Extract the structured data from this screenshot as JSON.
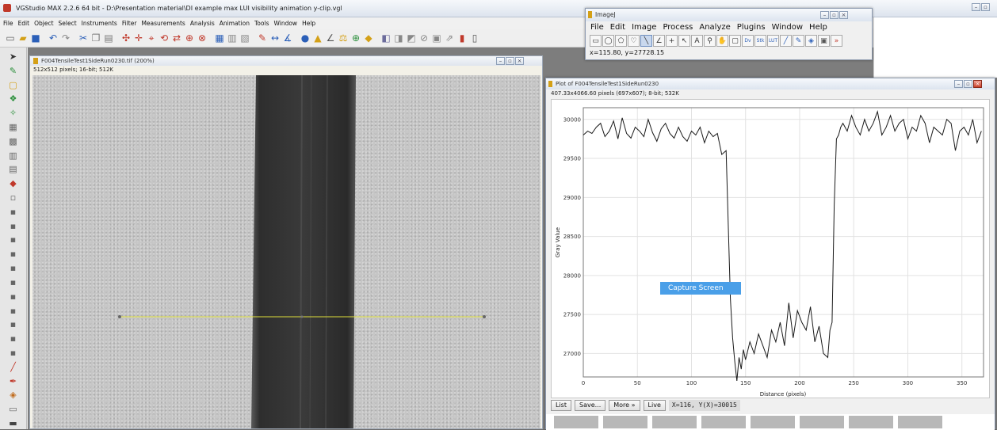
{
  "app": {
    "title": "VGStudio MAX 2.2.6 64 bit - D:\\Presentation material\\DI example max LUI visibility animation y-clip.vgl",
    "menu": [
      "File",
      "Edit",
      "Object",
      "Select",
      "Instruments",
      "Filter",
      "Measurements",
      "Analysis",
      "Animation",
      "Tools",
      "Window",
      "Help"
    ]
  },
  "image_window": {
    "title": "F004TensileTest1SideRun0230.tif (200%)",
    "info": "512x512 pixels; 16-bit; 512K"
  },
  "imagej": {
    "title": "ImageJ",
    "menu": [
      "File",
      "Edit",
      "Image",
      "Process",
      "Analyze",
      "Plugins",
      "Window",
      "Help"
    ],
    "status": "x=115.80, y=27728.15",
    "tools": [
      "rect",
      "oval",
      "poly",
      "free",
      "line",
      "angle",
      "point",
      "wand",
      "text",
      "zoom",
      "hand",
      "dropper",
      "dev",
      "stk",
      "lut",
      "brush",
      "pen",
      "ruler",
      "macro",
      "more"
    ]
  },
  "plot_window": {
    "title": "Plot of F004TensileTest1SideRun0230",
    "info": "407.33x4066.60 pixels (697x607); 8-bit; 532K",
    "buttons": {
      "list": "List",
      "save": "Save...",
      "more": "More »",
      "live": "Live"
    },
    "readout": "X=116, Y(X)=30015"
  },
  "capture_label": "Capture Screen",
  "chart_data": {
    "type": "line",
    "xlabel": "Distance (pixels)",
    "ylabel": "Gray Value",
    "xlim": [
      0,
      370
    ],
    "ylim": [
      26700,
      30150
    ],
    "xticks": [
      0,
      50,
      100,
      150,
      200,
      250,
      300,
      350
    ],
    "yticks": [
      27000,
      27500,
      28000,
      28500,
      29000,
      29500,
      30000
    ],
    "grid": true,
    "series": [
      {
        "x": [
          0,
          4,
          8,
          12,
          16,
          20,
          24,
          28,
          32,
          36,
          40,
          44,
          48,
          52,
          56,
          60,
          64,
          68,
          72,
          76,
          80,
          84,
          88,
          92,
          96,
          100,
          104,
          108,
          112,
          116,
          120,
          124,
          128,
          132,
          136,
          138,
          140,
          142,
          144,
          146,
          148,
          150,
          154,
          158,
          162,
          166,
          170,
          174,
          178,
          182,
          186,
          190,
          194,
          198,
          202,
          206,
          210,
          214,
          218,
          222,
          226,
          228,
          230,
          232,
          234,
          236,
          238,
          240,
          244,
          248,
          252,
          256,
          260,
          264,
          268,
          272,
          276,
          280,
          284,
          288,
          292,
          296,
          300,
          304,
          308,
          312,
          316,
          320,
          324,
          328,
          332,
          336,
          340,
          344,
          348,
          352,
          356,
          360,
          364,
          368
        ],
        "y": [
          29800,
          29850,
          29820,
          29900,
          29950,
          29780,
          29850,
          29980,
          29750,
          30020,
          29820,
          29760,
          29900,
          29850,
          29780,
          30000,
          29830,
          29720,
          29880,
          29950,
          29820,
          29760,
          29900,
          29780,
          29720,
          29850,
          29800,
          29900,
          29700,
          29850,
          29780,
          29820,
          29550,
          29600,
          27700,
          27200,
          26900,
          26650,
          26950,
          26800,
          27050,
          26920,
          27150,
          27000,
          27250,
          27100,
          26950,
          27300,
          27150,
          27400,
          27100,
          27650,
          27200,
          27550,
          27400,
          27300,
          27600,
          27150,
          27350,
          27000,
          26950,
          27300,
          27400,
          28900,
          29750,
          29800,
          29900,
          29950,
          29850,
          30050,
          29900,
          29800,
          30000,
          29850,
          29950,
          30100,
          29800,
          29900,
          30050,
          29850,
          29950,
          30000,
          29750,
          29900,
          29850,
          30050,
          29950,
          29700,
          29900,
          29850,
          29800,
          30000,
          29950,
          29600,
          29850,
          29900,
          29800,
          30000,
          29700,
          29850
        ]
      }
    ]
  }
}
